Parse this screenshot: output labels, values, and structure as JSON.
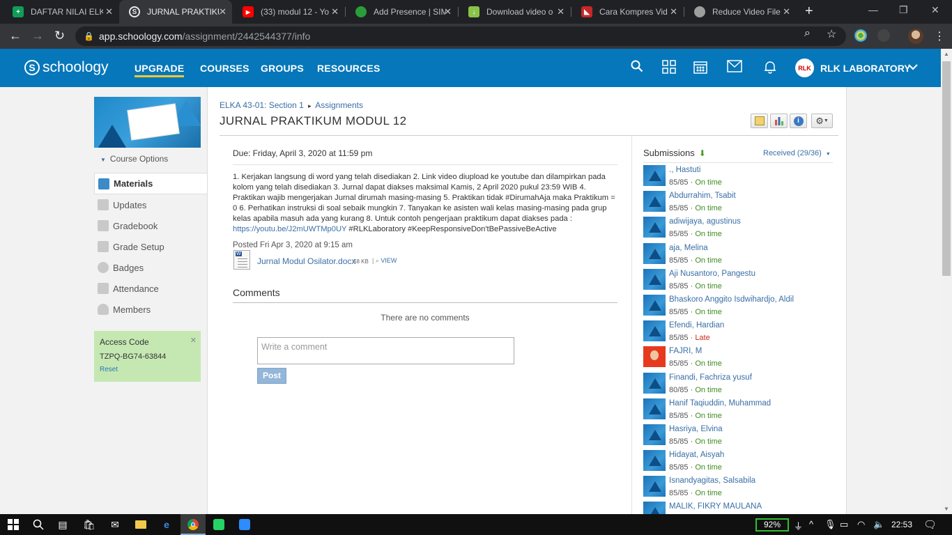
{
  "browser": {
    "tabs": [
      {
        "title": "DAFTAR NILAI ELKA",
        "icon": "sheets-icon",
        "color": "#0f9d58"
      },
      {
        "title": "JURNAL PRAKTIKUM",
        "icon": "schoology-icon",
        "color": "#35363a"
      },
      {
        "title": "(33) modul 12 - Yo",
        "icon": "youtube-icon",
        "color": "#ff0000"
      },
      {
        "title": "Add Presence | SIM",
        "icon": "sim-icon",
        "color": "#2a9d3a"
      },
      {
        "title": "Download video o",
        "icon": "download-icon",
        "color": "#8bc34a"
      },
      {
        "title": "Cara Kompres Vid",
        "icon": "video-icon",
        "color": "#c62828"
      },
      {
        "title": "Reduce Video File",
        "icon": "reduce-icon",
        "color": "#9e9e9e"
      }
    ],
    "url_host": "app.schoology.com",
    "url_path": "/assignment/2442544377/info"
  },
  "header": {
    "logo": "schoology",
    "nav": [
      "UPGRADE",
      "COURSES",
      "GROUPS",
      "RESOURCES"
    ],
    "user_name": "RLK LABORATORY",
    "user_initials": "RLK"
  },
  "sidebar": {
    "course_options": "Course Options",
    "items": [
      "Materials",
      "Updates",
      "Gradebook",
      "Grade Setup",
      "Badges",
      "Attendance",
      "Members"
    ],
    "access_title": "Access Code",
    "access_code": "TZPQ-BG74-63844",
    "access_reset": "Reset"
  },
  "main": {
    "breadcrumb_course": "ELKA 43-01: Section 1",
    "breadcrumb_sep": "▸",
    "breadcrumb_section": "Assignments",
    "title": "JURNAL PRAKTIKUM MODUL 12",
    "due": "Due: Friday, April 3, 2020 at 11:59 pm",
    "description": "1. Kerjakan langsung di word yang telah disediakan 2. Link video diupload ke youtube dan dilampirkan pada kolom yang telah disediakan 3. Jurnal dapat diakses maksimal Kamis, 2 April 2020 pukul 23:59 WIB 4. Praktikan wajib mengerjakan Jurnal dirumah masing-masing 5. Praktikan tidak #DirumahAja maka Praktikum = 0 6. Perhatikan instruksi di soal sebaik mungkin 7. Tanyakan ke asisten wali kelas masing-masing pada grup kelas apabila masuh ada yang kurang 8. Untuk contoh pengerjaan praktikum dapat diakses pada :",
    "link": "https://youtu.be/J2mUWTMp0UY",
    "hashtags": " #RLKLaboratory #KeepResponsiveDon'tBePassiveBeActive",
    "posted": "Posted Fri Apr 3, 2020 at 9:15 am",
    "file_name": "Jurnal Modul Osilator.docx",
    "file_size": "58 KB",
    "file_view": "VIEW",
    "comments_title": "Comments",
    "no_comments": "There are no comments",
    "comment_placeholder": "Write a comment",
    "post_label": "Post"
  },
  "submissions": {
    "title": "Submissions",
    "received": "Received (29/36)",
    "list": [
      {
        "name": "., Hastuti",
        "score": "85/85",
        "status": "On time"
      },
      {
        "name": "Abdurrahim, Tsabit",
        "score": "85/85",
        "status": "On time"
      },
      {
        "name": "adiwijaya, agustinus",
        "score": "85/85",
        "status": "On time"
      },
      {
        "name": "aja, Melina",
        "score": "85/85",
        "status": "On time"
      },
      {
        "name": "Aji Nusantoro, Pangestu",
        "score": "85/85",
        "status": "On time"
      },
      {
        "name": "Bhaskoro Anggito Isdwihardjo, Aldil",
        "score": "85/85",
        "status": "On time"
      },
      {
        "name": "Efendi, Hardian",
        "score": "85/85",
        "status": "Late"
      },
      {
        "name": "FAJRI, M",
        "score": "85/85",
        "status": "On time"
      },
      {
        "name": "Finandi, Fachriza yusuf",
        "score": "80/85",
        "status": "On time"
      },
      {
        "name": "Hanif Taqiuddin, Muhammad",
        "score": "85/85",
        "status": "On time"
      },
      {
        "name": "Hasriya, Elvina",
        "score": "85/85",
        "status": "On time"
      },
      {
        "name": "Hidayat, Aisyah",
        "score": "85/85",
        "status": "On time"
      },
      {
        "name": "Isnandyagitas, Salsabila",
        "score": "85/85",
        "status": "On time"
      },
      {
        "name": "MALIK, FIKRY MAULANA",
        "score": "",
        "status": ""
      }
    ]
  },
  "taskbar": {
    "battery": "92%",
    "clock": "22:53"
  },
  "colors": {
    "brand": "#0677ba",
    "upgrade_underline": "#ffc82c",
    "on_time": "#3d8b1f",
    "late": "#d0281b",
    "link": "#3a6ea5"
  }
}
